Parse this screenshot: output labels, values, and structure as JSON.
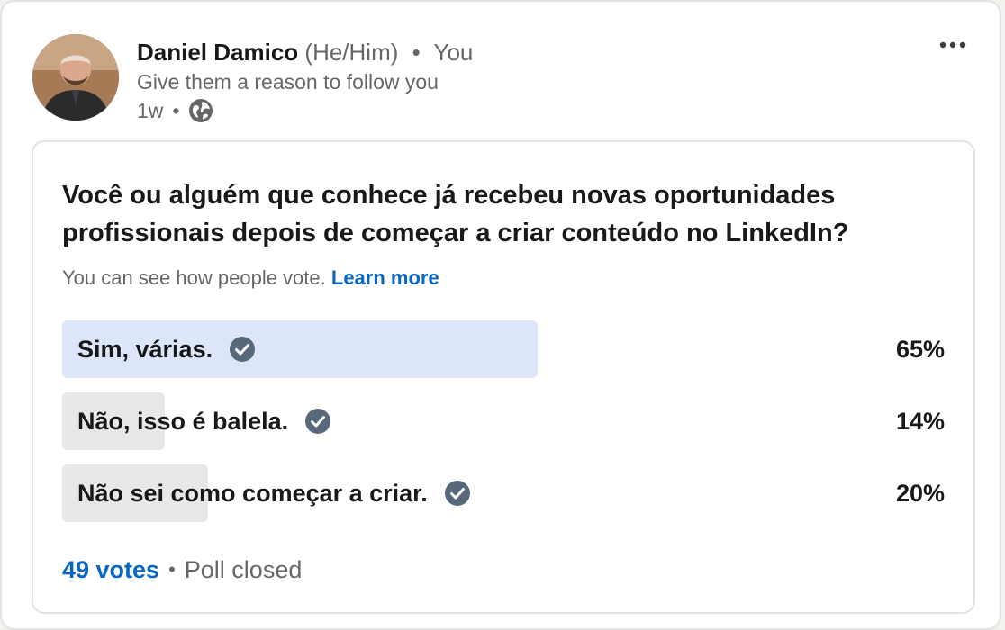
{
  "post": {
    "author_name": "Daniel Damico",
    "pronouns": "(He/Him)",
    "separator": "•",
    "connection": "You",
    "headline": "Give them a reason to follow you",
    "time": "1w",
    "visibility_icon": "globe-icon",
    "menu_icon": "more-horizontal-icon"
  },
  "poll": {
    "question": "Você ou alguém que conhece já recebeu novas oportunidades profissionais depois de começar a criar conteúdo no LinkedIn?",
    "visibility_note": "You can see how people vote.",
    "learn_more": "Learn more",
    "options": [
      {
        "label": "Sim, várias.",
        "percent_text": "65%",
        "percent": 0.65,
        "bar_color": "#dce6f8",
        "selected": true
      },
      {
        "label": "Não, isso é balela.",
        "percent_text": "14%",
        "percent": 0.14,
        "bar_color": "#e8e8e8",
        "selected": false
      },
      {
        "label": "Não sei como começar a criar.",
        "percent_text": "20%",
        "percent": 0.2,
        "bar_color": "#e8e8e8",
        "selected": false
      }
    ],
    "votes": "49 votes",
    "separator": "•",
    "status": "Poll closed",
    "check_icon": "check-circle-icon"
  },
  "colors": {
    "link": "#0a66c2",
    "check": "#56687a"
  }
}
